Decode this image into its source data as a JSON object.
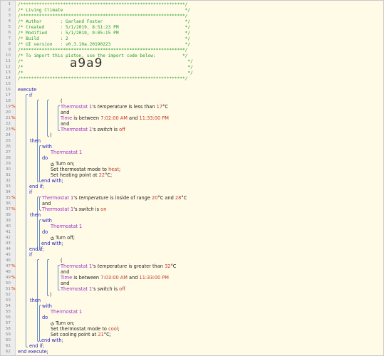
{
  "editor": {
    "header": [
      "/**************************************************************/",
      "/* Living Climate                                              */",
      "/**************************************************************/",
      "/* Author       : Garland Foster                               */",
      "/* Created      : 5/1/2019, 8:51:23 PM                         */",
      "/* Modified     : 5/1/2019, 9:05:15 PM                         */",
      "/* Build        : 2                                            */",
      "/* UI version   : v0.3.10a.20190223                            */",
      "/**************************************************************/",
      "/* To import this piston, use the import code below:          */",
      "/*                                                              */",
      "/*                                                              */",
      "/*                                                              */",
      "/**************************************************************/"
    ],
    "import_code": "a9a9",
    "flags": {
      "19": "%",
      "21": "%",
      "23": "%",
      "35": "%",
      "37": "%",
      "47": "%",
      "49": "%",
      "51": "%"
    },
    "kw": {
      "execute": "execute",
      "if": "if",
      "then": "then",
      "with": "with",
      "do": "do",
      "end_with": "end with;",
      "end_if": "end if;",
      "end_execute": "end execute;",
      "open": "(",
      "close": ")",
      "and": "and"
    },
    "device": "Thermostat 1",
    "time": "Time",
    "c1": {
      "prop": "temperature",
      "op": "is less than",
      "val": "17",
      "unit": "°C"
    },
    "c2": {
      "op": "is between",
      "from": "7:02:00 AM",
      "to": "11:33:00 PM"
    },
    "c3": {
      "prop": "switch",
      "op": "is",
      "val": "off"
    },
    "a1": {
      "turn": "Turn on;",
      "mode_pre": "Set thermostat mode to",
      "mode": "heat",
      "pt_pre": "Set heating point at",
      "pt": "22",
      "unit": "°C"
    },
    "c4": {
      "prop": "temperature",
      "op": "is inside of range",
      "lo": "20",
      "hi": "28",
      "unit": "°C",
      "and": "and"
    },
    "c5": {
      "prop": "switch",
      "op": "is",
      "val": "on"
    },
    "a2": {
      "turn": "Turn off;"
    },
    "c6": {
      "prop": "temperature",
      "op": "is greater than",
      "val": "32",
      "unit": "°C"
    },
    "c7": {
      "op": "is between",
      "from": "7:03:00 AM",
      "to": "11:33:00 PM"
    },
    "c8": {
      "prop": "switch",
      "op": "is",
      "val": "off"
    },
    "a3": {
      "turn": "Turn on;",
      "mode_pre": "Set thermostat mode to",
      "mode": "cool",
      "pt_pre": "Set cooling point at",
      "pt": "21",
      "unit": "°C"
    },
    "possessive": "'s"
  }
}
